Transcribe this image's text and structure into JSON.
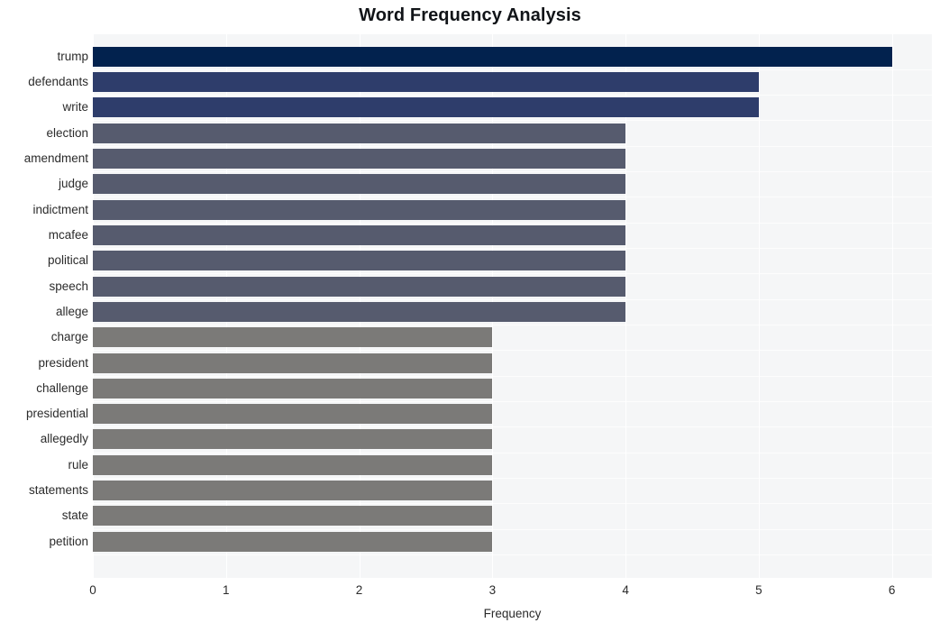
{
  "chart_data": {
    "type": "bar",
    "orientation": "horizontal",
    "title": "Word Frequency Analysis",
    "xlabel": "Frequency",
    "ylabel": "",
    "xlim": [
      0,
      6.3
    ],
    "xticks": [
      0,
      1,
      2,
      3,
      4,
      5,
      6
    ],
    "xtick_labels": [
      "0",
      "1",
      "2",
      "3",
      "4",
      "5",
      "6"
    ],
    "grid": true,
    "legend": null,
    "categories": [
      "trump",
      "defendants",
      "write",
      "election",
      "amendment",
      "judge",
      "indictment",
      "mcafee",
      "political",
      "speech",
      "allege",
      "charge",
      "president",
      "challenge",
      "presidential",
      "allegedly",
      "rule",
      "statements",
      "state",
      "petition"
    ],
    "values": [
      6,
      5,
      5,
      4,
      4,
      4,
      4,
      4,
      4,
      4,
      4,
      3,
      3,
      3,
      3,
      3,
      3,
      3,
      3,
      3
    ],
    "bar_colors": [
      "#02224e",
      "#2e3d6b",
      "#2e3d6b",
      "#565b6e",
      "#565b6e",
      "#565b6e",
      "#565b6e",
      "#565b6e",
      "#565b6e",
      "#565b6e",
      "#565b6e",
      "#7b7a78",
      "#7b7a78",
      "#7b7a78",
      "#7b7a78",
      "#7b7a78",
      "#7b7a78",
      "#7b7a78",
      "#7b7a78",
      "#7b7a78"
    ]
  },
  "style": {
    "plot_background": "#f5f6f7",
    "figure_background": "#ffffff",
    "grid_color": "#ffffff",
    "text_color": "#2b2b2b",
    "title_color": "#111418"
  }
}
